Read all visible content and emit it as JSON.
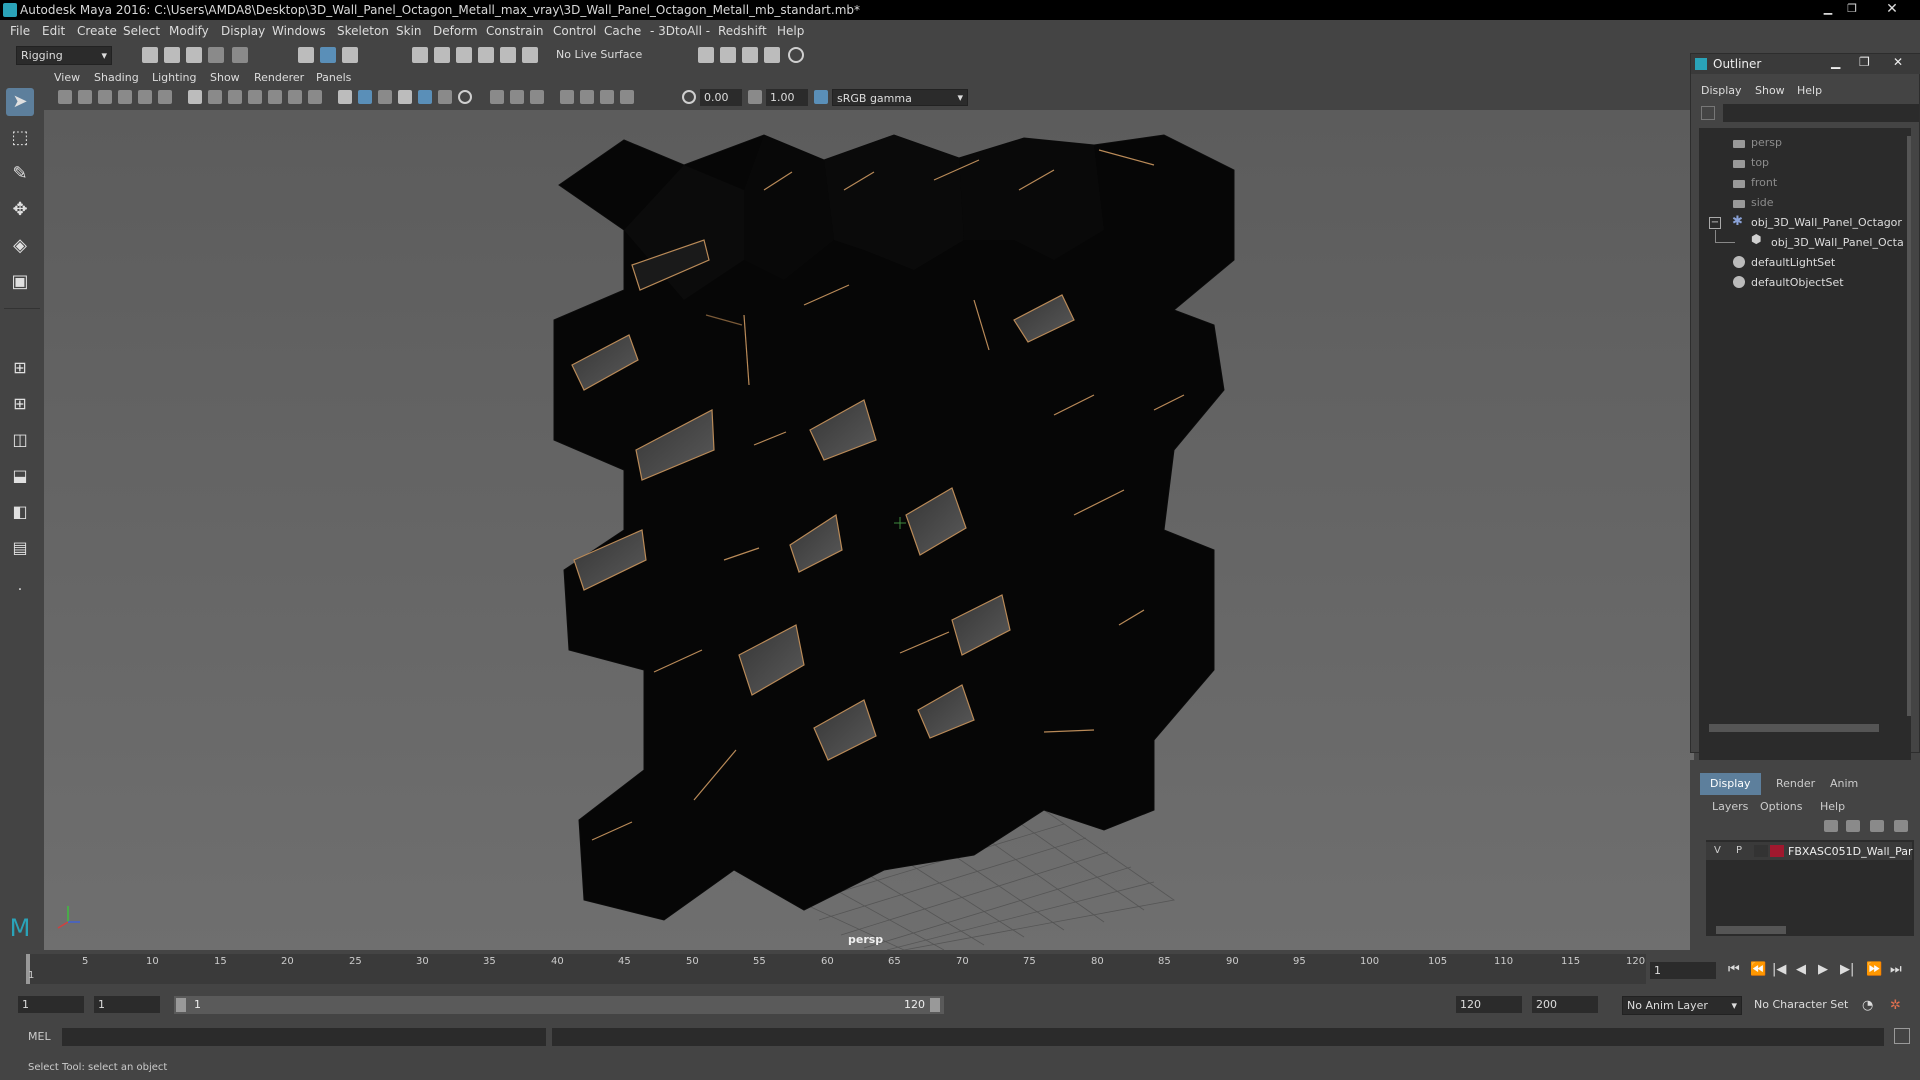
{
  "titlebar": {
    "title": "Autodesk Maya 2016: C:\\Users\\AMDA8\\Desktop\\3D_Wall_Panel_Octagon_Metall_max_vray\\3D_Wall_Panel_Octagon_Metall_mb_standart.mb*"
  },
  "menubar": [
    "File",
    "Edit",
    "Create",
    "Select",
    "Modify",
    "Display",
    "Windows",
    "Skeleton",
    "Skin",
    "Deform",
    "Constrain",
    "Control",
    "Cache",
    "- 3DtoAll -",
    "Redshift",
    "Help"
  ],
  "shelf": {
    "mode": "Rigging",
    "live_surface": "No Live Surface"
  },
  "panel_menu": [
    "View",
    "Shading",
    "Lighting",
    "Show",
    "Renderer",
    "Panels"
  ],
  "viewport_toolbar": {
    "exposure": "0.00",
    "gamma": "1.00",
    "color_space": "sRGB gamma"
  },
  "viewport": {
    "camera_label": "persp"
  },
  "outliner": {
    "title": "Outliner",
    "menu": [
      "Display",
      "Show",
      "Help"
    ],
    "items": [
      {
        "label": "persp",
        "kind": "camera"
      },
      {
        "label": "top",
        "kind": "camera"
      },
      {
        "label": "front",
        "kind": "camera"
      },
      {
        "label": "side",
        "kind": "camera"
      },
      {
        "label": "obj_3D_Wall_Panel_Octagor",
        "kind": "group"
      },
      {
        "label": "obj_3D_Wall_Panel_Octa",
        "kind": "mesh"
      },
      {
        "label": "defaultLightSet",
        "kind": "set"
      },
      {
        "label": "defaultObjectSet",
        "kind": "set"
      }
    ]
  },
  "layer_editor": {
    "tabs": [
      "Display",
      "Render",
      "Anim"
    ],
    "menu": [
      "Layers",
      "Options",
      "Help"
    ],
    "layer": {
      "v": "V",
      "p": "P",
      "name": "FBXASC051D_Wall_Par",
      "color": "#a0182e"
    }
  },
  "timeline": {
    "ticks": [
      "1",
      "5",
      "10",
      "15",
      "20",
      "25",
      "30",
      "35",
      "40",
      "45",
      "50",
      "55",
      "60",
      "65",
      "70",
      "75",
      "80",
      "85",
      "90",
      "95",
      "100",
      "105",
      "110",
      "115",
      "120"
    ],
    "current_frame": "1"
  },
  "range": {
    "start": "1",
    "playback_start": "1",
    "slider_start": "1",
    "slider_end": "120",
    "playback_end": "120",
    "end": "200",
    "anim_layer": "No Anim Layer",
    "character_set": "No Character Set"
  },
  "cmdline": {
    "lang": "MEL"
  },
  "helpline": {
    "text": "Select Tool: select an object"
  }
}
